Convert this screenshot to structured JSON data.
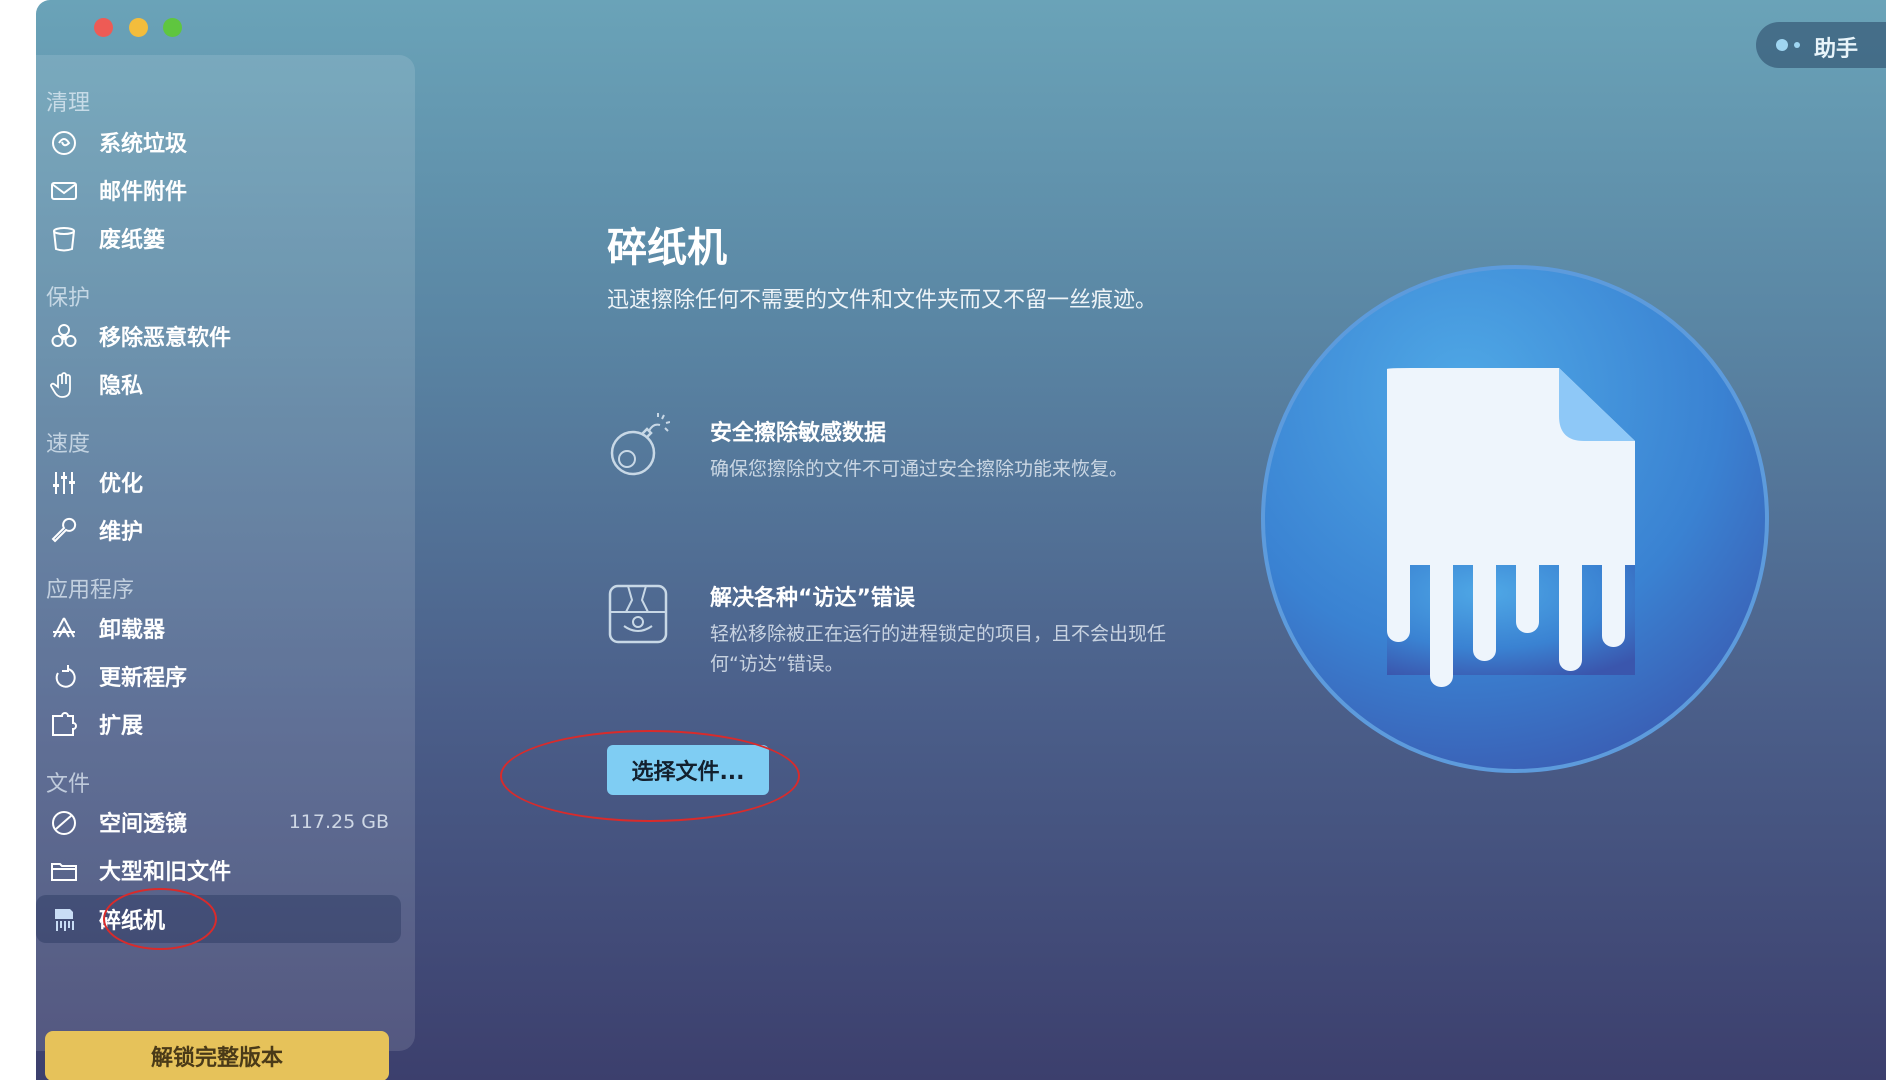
{
  "sidebar": {
    "sections": [
      {
        "title": "清理",
        "items": [
          {
            "label": "系统垃圾",
            "icon": "system-junk-icon"
          },
          {
            "label": "邮件附件",
            "icon": "mail-icon"
          },
          {
            "label": "废纸篓",
            "icon": "trash-icon"
          }
        ]
      },
      {
        "title": "保护",
        "items": [
          {
            "label": "移除恶意软件",
            "icon": "biohazard-icon"
          },
          {
            "label": "隐私",
            "icon": "hand-icon"
          }
        ]
      },
      {
        "title": "速度",
        "items": [
          {
            "label": "优化",
            "icon": "sliders-icon"
          },
          {
            "label": "维护",
            "icon": "wrench-icon"
          }
        ]
      },
      {
        "title": "应用程序",
        "items": [
          {
            "label": "卸载器",
            "icon": "uninstaller-icon"
          },
          {
            "label": "更新程序",
            "icon": "updater-icon"
          },
          {
            "label": "扩展",
            "icon": "extensions-icon"
          }
        ]
      },
      {
        "title": "文件",
        "items": [
          {
            "label": "空间透镜",
            "icon": "space-lens-icon",
            "value": "117.25 GB"
          },
          {
            "label": "大型和旧文件",
            "icon": "folder-icon"
          },
          {
            "label": "碎纸机",
            "icon": "shredder-icon",
            "active": true
          }
        ]
      }
    ],
    "unlock_label": "解锁完整版本"
  },
  "assistant_label": "助手",
  "main": {
    "title": "碎纸机",
    "description": "迅速擦除任何不需要的文件和文件夹而又不留一丝痕迹。",
    "features": [
      {
        "title": "安全擦除敏感数据",
        "desc": "确保您擦除的文件不可通过安全擦除功能来恢复。",
        "icon": "bomb-icon"
      },
      {
        "title": "解决各种“访达”错误",
        "desc": "轻松移除被正在运行的进程锁定的项目，且不会出现任何“访达”错误。",
        "icon": "finder-error-icon"
      }
    ],
    "choose_button": "选择文件..."
  },
  "colors": {
    "accent_button": "#7fcdf3",
    "unlock_button": "#e6c25a",
    "annotation": "#d92b2b"
  }
}
